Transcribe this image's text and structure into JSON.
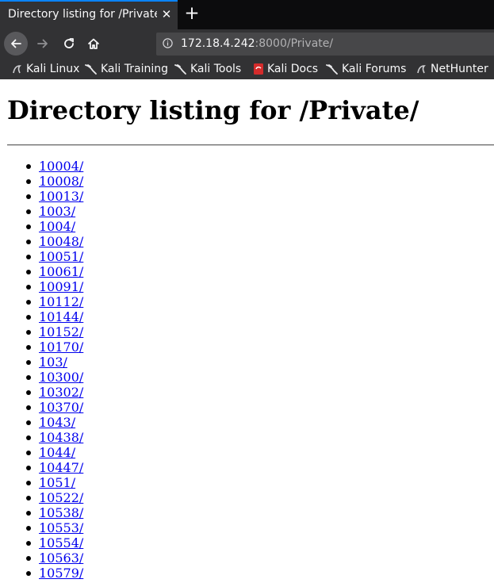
{
  "browser": {
    "tab_title": "Directory listing for /Private/",
    "tab_close_icon": "close-icon",
    "new_tab_label": "+",
    "url": {
      "host": "172.18.4.242",
      "rest": ":8000/Private/"
    },
    "bookmarks": [
      {
        "label": "Kali Linux",
        "icon": "kali-logo-icon"
      },
      {
        "label": "Kali Training",
        "icon": "kali-dragon-icon"
      },
      {
        "label": "Kali Tools",
        "icon": "kali-dragon-icon"
      },
      {
        "label": "Kali Docs",
        "icon": "kali-docs-icon"
      },
      {
        "label": "Kali Forums",
        "icon": "kali-dragon-icon"
      },
      {
        "label": "NetHunter",
        "icon": "kali-logo-icon"
      }
    ],
    "colors": {
      "tab_accent": "#0a84ff",
      "chrome_dark": "#0c0c0d",
      "chrome": "#323234",
      "link": "#0000ee"
    }
  },
  "page": {
    "heading": "Directory listing for /Private/",
    "entries": [
      "10004/",
      "10008/",
      "10013/",
      "1003/",
      "1004/",
      "10048/",
      "10051/",
      "10061/",
      "10091/",
      "10112/",
      "10144/",
      "10152/",
      "10170/",
      "103/",
      "10300/",
      "10302/",
      "10370/",
      "1043/",
      "10438/",
      "1044/",
      "10447/",
      "1051/",
      "10522/",
      "10538/",
      "10553/",
      "10554/",
      "10563/",
      "10579/"
    ]
  }
}
